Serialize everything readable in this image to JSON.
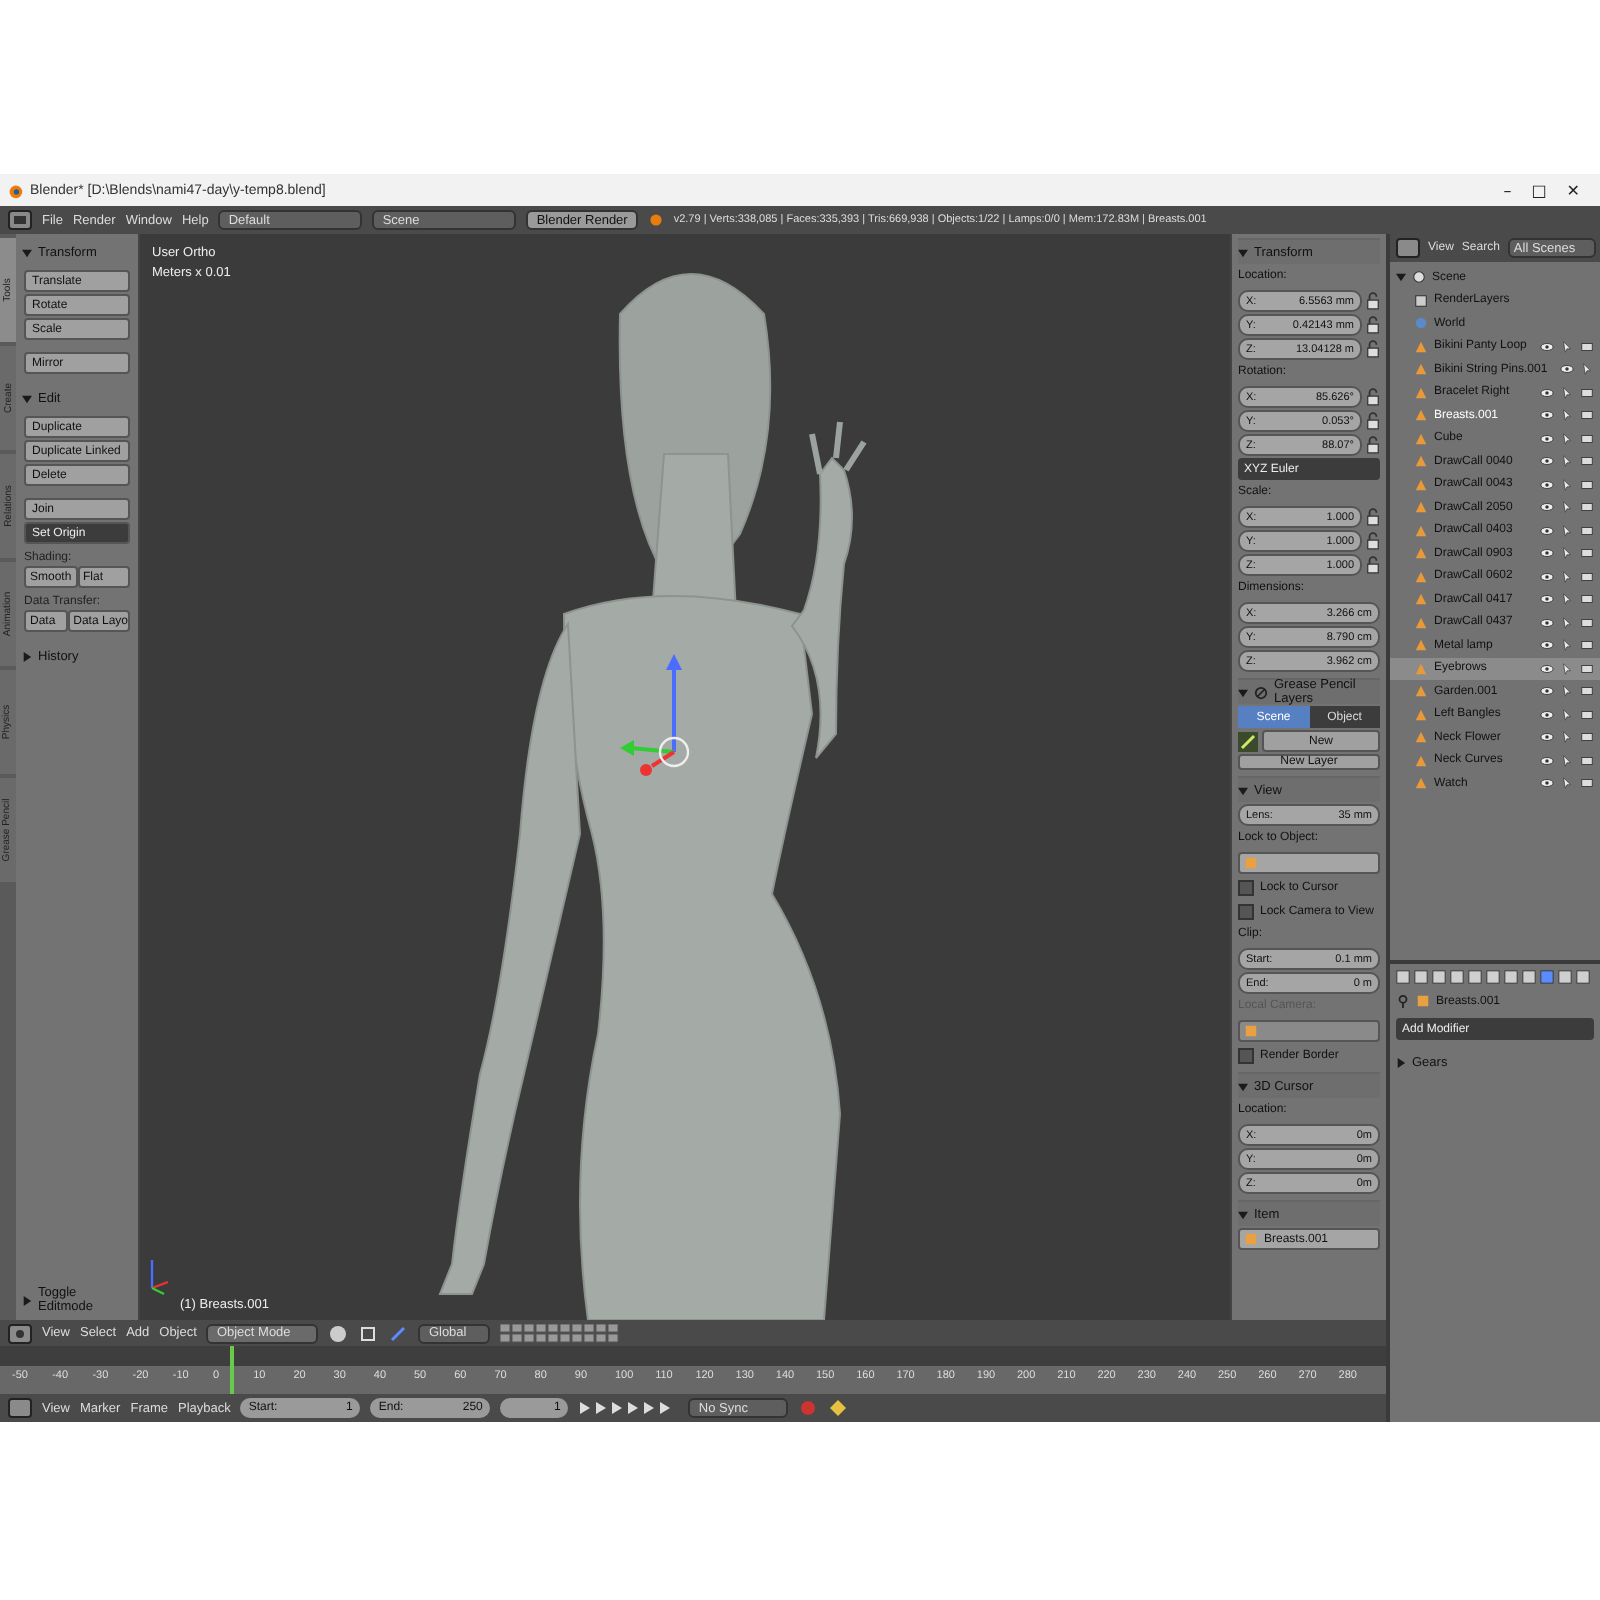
{
  "window": {
    "title": "Blender* [D:\\Blends\\nami47-day\\y-temp8.blend]",
    "controls": [
      "–",
      "□",
      "✕"
    ]
  },
  "info_header": {
    "menus": [
      "File",
      "Render",
      "Window",
      "Help"
    ],
    "layout": "Default",
    "scene": "Scene",
    "engine": "Blender Render",
    "stats": "v2.79 | Verts:338,085 | Faces:335,393 | Tris:669,938 | Objects:1/22 | Lamps:0/0 | Mem:172.83M | Breasts.001"
  },
  "tool_tabs": [
    {
      "label": "Tools",
      "selected": true
    },
    {
      "label": "Create",
      "selected": false
    },
    {
      "label": "Relations",
      "selected": false
    },
    {
      "label": "Animation",
      "selected": false
    },
    {
      "label": "Physics",
      "selected": false
    },
    {
      "label": "Grease Pencil",
      "selected": false
    }
  ],
  "toolshelf": {
    "panels": [
      {
        "title": "Transform",
        "expanded": true,
        "items": [
          {
            "kind": "button",
            "label": "Translate"
          },
          {
            "kind": "button",
            "label": "Rotate"
          },
          {
            "kind": "button",
            "label": "Scale"
          },
          {
            "kind": "spacer"
          },
          {
            "kind": "button",
            "label": "Mirror"
          }
        ]
      },
      {
        "title": "Edit",
        "expanded": true,
        "items": [
          {
            "kind": "button",
            "label": "Duplicate"
          },
          {
            "kind": "button",
            "label": "Duplicate Linked"
          },
          {
            "kind": "button",
            "label": "Delete"
          },
          {
            "kind": "spacer"
          },
          {
            "kind": "button",
            "label": "Join"
          },
          {
            "kind": "dropdown",
            "label": "Set Origin"
          },
          {
            "kind": "label",
            "label": "Shading:"
          },
          {
            "kind": "pair",
            "labels": [
              "Smooth",
              "Flat"
            ]
          },
          {
            "kind": "label",
            "label": "Data Transfer:"
          },
          {
            "kind": "pair",
            "labels": [
              "Data",
              "Data Layo"
            ]
          }
        ]
      },
      {
        "title": "History",
        "expanded": false
      }
    ],
    "footer": {
      "title": "Toggle Editmode",
      "expanded": false
    }
  },
  "viewport": {
    "view_name": "User Ortho",
    "units": "Meters x 0.01",
    "object_label": "(1) Breasts.001"
  },
  "properties_panel": {
    "sections": [
      {
        "title": "Transform",
        "icon": false,
        "expanded": true,
        "rows": [
          {
            "kind": "label",
            "text": "Location:"
          },
          {
            "kind": "field",
            "label": "X:",
            "value": "6.5563 mm",
            "locked": false
          },
          {
            "kind": "field",
            "label": "Y:",
            "value": "0.42143 mm",
            "locked": false
          },
          {
            "kind": "field",
            "label": "Z:",
            "value": "13.04128 m",
            "locked": false
          },
          {
            "kind": "label",
            "text": "Rotation:"
          },
          {
            "kind": "field",
            "label": "X:",
            "value": "85.626°",
            "locked": false
          },
          {
            "kind": "field",
            "label": "Y:",
            "value": "0.053°",
            "locked": false
          },
          {
            "kind": "field",
            "label": "Z:",
            "value": "88.07°",
            "locked": false
          },
          {
            "kind": "dropdown",
            "text": "XYZ Euler"
          },
          {
            "kind": "label",
            "text": "Scale:"
          },
          {
            "kind": "field",
            "label": "X:",
            "value": "1.000",
            "locked": false
          },
          {
            "kind": "field",
            "label": "Y:",
            "value": "1.000",
            "locked": false
          },
          {
            "kind": "field",
            "label": "Z:",
            "value": "1.000",
            "locked": false
          },
          {
            "kind": "label",
            "text": "Dimensions:"
          },
          {
            "kind": "field",
            "label": "X:",
            "value": "3.266 cm"
          },
          {
            "kind": "field",
            "label": "Y:",
            "value": "8.790 cm"
          },
          {
            "kind": "field",
            "label": "Z:",
            "value": "3.962 cm"
          }
        ]
      },
      {
        "title": "Grease Pencil Layers",
        "icon": true,
        "expanded": true,
        "rows": [
          {
            "kind": "tabs",
            "items": [
              {
                "label": "Scene",
                "selected": true
              },
              {
                "label": "Object",
                "selected": false
              }
            ]
          },
          {
            "kind": "new",
            "text": "New"
          },
          {
            "kind": "button",
            "text": "New Layer"
          }
        ]
      },
      {
        "title": "View",
        "icon": false,
        "expanded": true,
        "rows": [
          {
            "kind": "field",
            "label": "Lens:",
            "value": "35 mm"
          },
          {
            "kind": "label",
            "text": "Lock to Object:"
          },
          {
            "kind": "object_field",
            "dim": false
          },
          {
            "kind": "check",
            "text": "Lock to Cursor",
            "checked": false
          },
          {
            "kind": "check",
            "text": "Lock Camera to View",
            "checked": false
          },
          {
            "kind": "label",
            "text": "Clip:"
          },
          {
            "kind": "field",
            "label": "Start:",
            "value": "0.1 mm"
          },
          {
            "kind": "field",
            "label": "End:",
            "value": "0 m"
          },
          {
            "kind": "dim_label",
            "text": "Local Camera:"
          },
          {
            "kind": "object_field",
            "dim": true
          },
          {
            "kind": "check",
            "text": "Render Border",
            "checked": false
          }
        ]
      },
      {
        "title": "3D Cursor",
        "icon": false,
        "expanded": true,
        "rows": [
          {
            "kind": "label",
            "text": "Location:"
          },
          {
            "kind": "field",
            "label": "X:",
            "value": "0m"
          },
          {
            "kind": "field",
            "label": "Y:",
            "value": "0m"
          },
          {
            "kind": "field",
            "label": "Z:",
            "value": "0m"
          }
        ]
      },
      {
        "title": "Item",
        "icon": false,
        "expanded": true,
        "rows": [
          {
            "kind": "object_field",
            "dim": false,
            "value": "Breasts.001"
          }
        ]
      }
    ]
  },
  "outliner": {
    "menus": [
      "View",
      "Search"
    ],
    "filter": "All Scenes",
    "tree": [
      {
        "name": "Scene",
        "kind": "scene",
        "expanded": true,
        "children": [
          {
            "name": "RenderLayers",
            "kind": "layers"
          },
          {
            "name": "World",
            "kind": "world"
          },
          {
            "name": "Bikini Panty Loop",
            "kind": "object",
            "selected": false,
            "active": false
          },
          {
            "name": "Bikini String Pins.001",
            "kind": "object",
            "selected": false,
            "active": false
          },
          {
            "name": "Bracelet Right",
            "kind": "object",
            "selected": false,
            "active": false
          },
          {
            "name": "Breasts.001",
            "kind": "object",
            "selected": false,
            "active": true
          },
          {
            "name": "Cube",
            "kind": "object",
            "selected": false,
            "active": false
          },
          {
            "name": "DrawCall 0040",
            "kind": "object",
            "selected": false,
            "active": false
          },
          {
            "name": "DrawCall 0043",
            "kind": "object",
            "selected": false,
            "active": false
          },
          {
            "name": "DrawCall 2050",
            "kind": "object",
            "selected": false,
            "active": false
          },
          {
            "name": "DrawCall 0403",
            "kind": "object",
            "selected": false,
            "active": false
          },
          {
            "name": "DrawCall 0903",
            "kind": "object",
            "selected": false,
            "active": false
          },
          {
            "name": "DrawCall 0602",
            "kind": "object",
            "selected": false,
            "active": false
          },
          {
            "name": "DrawCall 0417",
            "kind": "object",
            "selected": false,
            "active": false
          },
          {
            "name": "DrawCall 0437",
            "kind": "object",
            "selected": false,
            "active": false
          },
          {
            "name": "Metal lamp",
            "kind": "object",
            "selected": false,
            "active": false
          },
          {
            "name": "Eyebrows",
            "kind": "object",
            "selected": true,
            "active": false
          },
          {
            "name": "Garden.001",
            "kind": "object",
            "selected": false,
            "active": false
          },
          {
            "name": "Left Bangles",
            "kind": "object",
            "selected": false,
            "active": false
          },
          {
            "name": "Neck Flower",
            "kind": "object",
            "selected": false,
            "active": false
          },
          {
            "name": "Neck Curves",
            "kind": "object",
            "selected": false,
            "active": false
          },
          {
            "name": "Watch",
            "kind": "object",
            "selected": false,
            "active": false
          }
        ]
      }
    ]
  },
  "modifiers": {
    "object": "Breasts.001",
    "add": "Add Modifier",
    "panel": {
      "title": "Gears",
      "expanded": false
    }
  },
  "viewport_header": {
    "menus": [
      "View",
      "Select",
      "Add",
      "Object"
    ],
    "mode": "Object Mode",
    "orientation": "Global"
  },
  "timeline": {
    "ticks": [
      "-50",
      "-40",
      "-30",
      "-20",
      "-10",
      "0",
      "10",
      "20",
      "30",
      "40",
      "50",
      "60",
      "70",
      "80",
      "90",
      "100",
      "110",
      "120",
      "130",
      "140",
      "150",
      "160",
      "170",
      "180",
      "190",
      "200",
      "210",
      "220",
      "230",
      "240",
      "250",
      "260",
      "270",
      "280"
    ],
    "menus": [
      "View",
      "Marker",
      "Frame",
      "Playback"
    ],
    "start": {
      "label": "Start:",
      "value": "1"
    },
    "end": {
      "label": "End:",
      "value": "250"
    },
    "frame": "1",
    "sync": "No Sync"
  }
}
